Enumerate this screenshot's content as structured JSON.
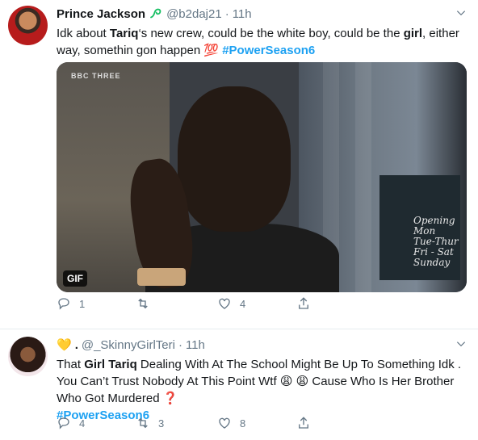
{
  "tweet1": {
    "name": "Prince Jackson",
    "handle": "@b2daj21",
    "separator": "·",
    "time": "11h",
    "text_segments": {
      "s1": "Idk about ",
      "s2": "Tariq",
      "s3": "‘s new crew, could be the white boy, could be the ",
      "s4": "girl",
      "s5": ", either",
      "s6": "way, somethin gon happen ",
      "emoji": "💯",
      "hashtag": "#PowerSeason6"
    },
    "media": {
      "badge": "GIF",
      "logo_text": "BBC THREE",
      "sign_text": [
        "Opening",
        "Mon",
        "Tue-Thur",
        "Fri - Sat",
        "Sunday"
      ]
    },
    "actions": {
      "replies": "1",
      "retweets": "",
      "likes": "4"
    }
  },
  "tweet2": {
    "name_emoji": "💛",
    "name_separator": ".",
    "handle": "@_SkinnyGirlTeri",
    "separator": "·",
    "time": "11h",
    "text_segments": {
      "s1": "That ",
      "s2": "Girl Tariq",
      "s3": " Dealing With At The School Might Be Up To Something Idk .",
      "s4": "You Can’t Trust Nobody At This Point Wtf ",
      "emoji1": "😩",
      "emoji2": "😩",
      "s5": " Cause Who Is Her Brother",
      "s6": "Who Got Murdered ",
      "emoji3": "❓",
      "hashtag": "#PowerSeason6"
    },
    "actions": {
      "replies": "4",
      "retweets": "3",
      "likes": "8"
    }
  },
  "icons": {
    "reply": "reply-icon",
    "retweet": "retweet-icon",
    "like": "heart-icon",
    "share": "share-icon",
    "caret": "chevron-down-icon",
    "verified_badge": "verified-icon"
  },
  "colors": {
    "link": "#1da1f2",
    "muted": "#657786",
    "text": "#14171a",
    "badge_green": "#17bf63"
  }
}
